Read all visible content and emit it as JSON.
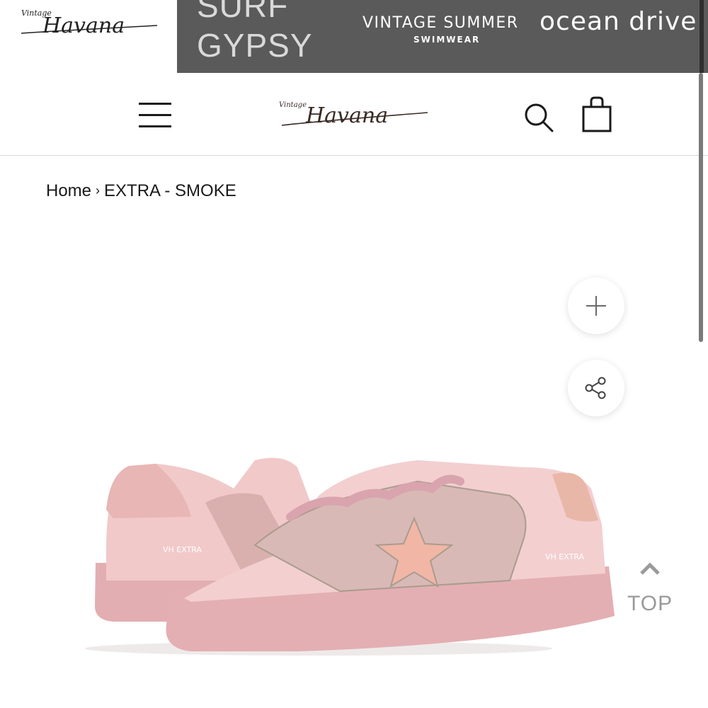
{
  "brand_strip": {
    "logo_small": {
      "top_word": "Vintage",
      "main_word": "Havana"
    },
    "surf_line1": "SURF",
    "surf_line2": "GYPSY",
    "vintage_summer_title": "VINTAGE SUMMER",
    "vintage_summer_sub": "SWIMWEAR",
    "ocean_drive": "ocean drive",
    "background_color": "#5a5a5a"
  },
  "header": {
    "menu_icon": "hamburger-menu-icon",
    "logo": {
      "top_word": "Vintage",
      "main_word": "Havana"
    },
    "search_icon": "search-icon",
    "cart_icon": "shopping-bag-icon"
  },
  "breadcrumb": {
    "home": "Home",
    "separator": "›",
    "current": "EXTRA - SMOKE"
  },
  "actions": {
    "zoom_icon": "plus-icon",
    "share_icon": "share-icon"
  },
  "product": {
    "image_alt": "pink low-top sneakers with star"
  },
  "back_to_top": {
    "icon": "chevron-up-icon",
    "label": "TOP"
  }
}
